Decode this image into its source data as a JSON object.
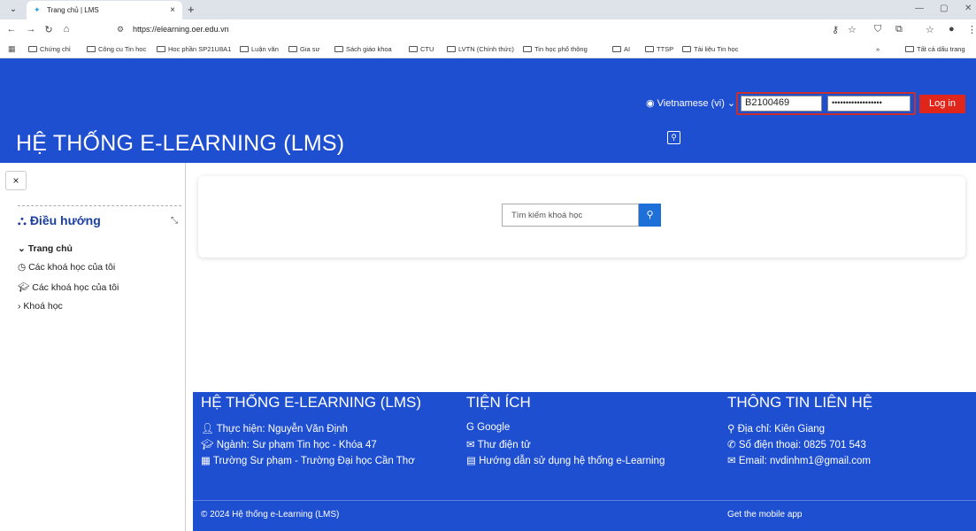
{
  "browser": {
    "tab_title": "Trang chủ | LMS",
    "url": "https://elearning.oer.edu.vn",
    "bookmarks": [
      "Chứng chỉ",
      "Công cu Tin hoc",
      "Hoc phần SP21U8A1",
      "Luận văn",
      "Gia sư",
      "Sách giáo khoa",
      "CTU",
      "LVTN (Chính thức)",
      "Tin học phổ thông",
      "AI",
      "TTSP",
      "Tài liệu Tin học"
    ],
    "bookmarks_more": "»",
    "all_bookmarks": "Tất cả dấu trang"
  },
  "header": {
    "language": "Vietnamese (vi)",
    "username": "B2100469",
    "password": "••••••••••••••••••",
    "login_label": "Log in",
    "site_title": "HỆ THỐNG E-LEARNING (LMS)"
  },
  "sidebar": {
    "close_label": "×",
    "nav_title": "Điều hướng",
    "items": [
      "Trang chủ",
      "Các khoá học của tôi",
      "Các khoá học của tôi",
      "Khoá học"
    ]
  },
  "main": {
    "search_placeholder": "Tìm kiếm khoá học"
  },
  "footer": {
    "col1_title": "HỆ THỐNG E-LEARNING (LMS)",
    "col1_lines": [
      "Thực hiện: Nguyễn Văn Định",
      "Ngành: Sư phạm Tin học - Khóa 47",
      "Trường Sư phạm - Trường Đại học Cần Thơ"
    ],
    "col2_title": "TIỆN ÍCH",
    "col2_lines": [
      "Google",
      "Thư điện tử",
      "Hướng dẫn sử dụng hệ thống e-Learning"
    ],
    "col3_title": "THÔNG TIN LIÊN HỆ",
    "col3_lines": [
      "Địa chỉ: Kiên Giang",
      "Số điện thoại: 0825 701 543",
      "Email: nvdinhm1@gmail.com"
    ],
    "copyright": "© 2024 Hệ thống e-Learning (LMS)",
    "mobile_app": "Get the mobile app"
  },
  "colors": {
    "brand_blue": "#1f4fd1",
    "login_red": "#e0251b",
    "highlight_red": "#c9302c"
  }
}
